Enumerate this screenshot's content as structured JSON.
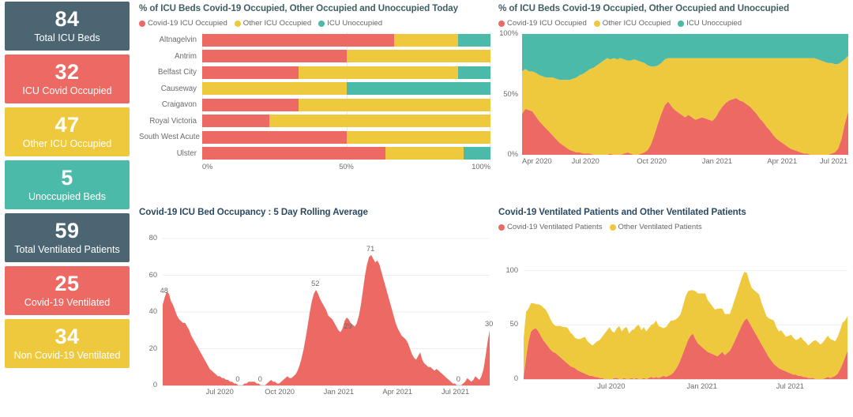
{
  "kpis": [
    {
      "value": "84",
      "label": "Total ICU Beds",
      "color": "#4b6573",
      "name": "total-icu-beds"
    },
    {
      "value": "32",
      "label": "ICU Covid Occupied",
      "color": "#ec6a63",
      "name": "icu-covid-occupied"
    },
    {
      "value": "47",
      "label": "Other ICU Occupied",
      "color": "#efc93d",
      "name": "other-icu-occupied"
    },
    {
      "value": "5",
      "label": "Unoccupied Beds",
      "color": "#4cbaa8",
      "name": "unoccupied-beds"
    },
    {
      "value": "59",
      "label": "Total Ventilated Patients",
      "color": "#4b6573",
      "name": "total-ventilated-patients"
    },
    {
      "value": "25",
      "label": "Covid-19 Ventilated",
      "color": "#ec6a63",
      "name": "covid-19-ventilated"
    },
    {
      "value": "34",
      "label": "Non Covid-19 Ventilated",
      "color": "#efc93d",
      "name": "non-covid-19-ventilated"
    }
  ],
  "colors": {
    "red": "#ec6a63",
    "yellow": "#efc93d",
    "teal": "#4cbaa8",
    "slate": "#4b6573",
    "title": "#3f5f63",
    "title_navy": "#2c4a62"
  },
  "panels": {
    "today": {
      "title": "% of ICU Beds Covid-19 Occupied, Other Occupied and Unoccupied Today",
      "legend": [
        "Covid-19 ICU Occupied",
        "Other ICU Occupied",
        "ICU Unoccupied"
      ]
    },
    "trend": {
      "title": "% of ICU Beds Covid-19 Occupied, Other Occupied and Unoccupied",
      "legend": [
        "Covid-19 ICU Occupied",
        "Other ICU Occupied",
        "ICU Unoccupied"
      ]
    },
    "rolling": {
      "title": "Covid-19 ICU Bed Occupancy : 5 Day Rolling Average",
      "legend": []
    },
    "vent": {
      "title": "Covid-19 Ventilated Patients and Other Ventilated Patients",
      "legend": [
        "Covid-19 Ventilated Patients",
        "Other Ventilated Patients"
      ]
    }
  },
  "chart_data": [
    {
      "type": "bar",
      "id": "icu-beds-today",
      "orientation": "horizontal",
      "stacked": true,
      "normalized": true,
      "title": "% of ICU Beds Covid-19 Occupied, Other Occupied and Unoccupied Today",
      "xlabel": "",
      "ylabel": "",
      "xlim": [
        0,
        100
      ],
      "xticks": [
        "0%",
        "50%",
        "100%"
      ],
      "xtick_values": [
        0,
        50,
        100
      ],
      "grid": true,
      "legend_position": "top",
      "categories": [
        "Altnagelvin",
        "Antrim",
        "Belfast City",
        "Causeway",
        "Craigavon",
        "Royal Victoria",
        "South West Acute",
        "Ulster"
      ],
      "series": [
        {
          "name": "Covid-19 ICU Occupied",
          "color": "#ec6a63",
          "values": [
            66.6,
            50.1,
            33.4,
            0,
            33.4,
            23.4,
            50.0,
            63.5
          ]
        },
        {
          "name": "Other ICU Occupied",
          "color": "#efc93d",
          "values": [
            22.3,
            49.9,
            55.5,
            50.0,
            66.6,
            76.6,
            50.0,
            27.3
          ]
        },
        {
          "name": "ICU Unoccupied",
          "color": "#4cbaa8",
          "values": [
            11.1,
            0,
            11.1,
            50.0,
            0,
            0,
            0,
            9.2
          ]
        }
      ]
    },
    {
      "type": "area",
      "id": "icu-beds-trend",
      "stacked": true,
      "normalized": true,
      "title": "% of ICU Beds Covid-19 Occupied, Other Occupied and Unoccupied",
      "xlabel": "",
      "ylabel": "",
      "ylim": [
        0,
        100
      ],
      "yticks": [
        "0%",
        "50%",
        "100%"
      ],
      "ytick_values": [
        0,
        50,
        100
      ],
      "xticks": [
        "Apr 2020",
        "Jul 2020",
        "Oct 2020",
        "Jan 2021",
        "Apr 2021",
        "Jul 2021"
      ],
      "grid": false,
      "legend_position": "top",
      "x_range": [
        "Apr 2020",
        "Aug 2021"
      ],
      "series": [
        {
          "name": "Covid-19 ICU Occupied",
          "color": "#ec6a63",
          "values": [
            34,
            38,
            37,
            36,
            32,
            28,
            25,
            22,
            19,
            16,
            13,
            10,
            8,
            6,
            4,
            3,
            2,
            2,
            1,
            1,
            1,
            0,
            0,
            0,
            0,
            0,
            1,
            0,
            0,
            0,
            1,
            2,
            1,
            0,
            0,
            1,
            2,
            4,
            9,
            17,
            26,
            34,
            41,
            44,
            40,
            37,
            35,
            33,
            31,
            33,
            31,
            29,
            30,
            31,
            30,
            29,
            28,
            31,
            36,
            40,
            43,
            45,
            46,
            47,
            45,
            44,
            42,
            40,
            37,
            34,
            30,
            27,
            23,
            20,
            16,
            13,
            11,
            9,
            7,
            5,
            4,
            3,
            2,
            1,
            1,
            0,
            0,
            0,
            0,
            0,
            0,
            1,
            2,
            5,
            13,
            26,
            36
          ]
        },
        {
          "name": "Other ICU Occupied",
          "color": "#efc93d",
          "values": [
            35,
            33,
            32,
            33,
            36,
            38,
            40,
            42,
            45,
            48,
            50,
            52,
            54,
            56,
            58,
            60,
            62,
            64,
            66,
            68,
            70,
            72,
            74,
            76,
            78,
            80,
            78,
            80,
            79,
            80,
            78,
            76,
            77,
            79,
            78,
            76,
            74,
            70,
            64,
            56,
            48,
            42,
            38,
            36,
            40,
            43,
            45,
            47,
            49,
            47,
            49,
            51,
            50,
            49,
            50,
            51,
            52,
            49,
            44,
            40,
            37,
            35,
            34,
            33,
            35,
            36,
            38,
            40,
            43,
            46,
            50,
            53,
            57,
            60,
            64,
            67,
            69,
            71,
            73,
            75,
            76,
            77,
            78,
            79,
            79,
            80,
            80,
            79,
            78,
            77,
            76,
            75,
            73,
            70,
            64,
            53,
            46
          ]
        },
        {
          "name": "ICU Unoccupied",
          "color": "#4cbaa8",
          "values": [
            31,
            29,
            31,
            31,
            32,
            34,
            35,
            36,
            36,
            36,
            37,
            38,
            38,
            38,
            38,
            37,
            36,
            34,
            33,
            31,
            29,
            28,
            26,
            24,
            22,
            20,
            21,
            20,
            21,
            20,
            21,
            22,
            22,
            21,
            22,
            23,
            24,
            26,
            27,
            27,
            26,
            24,
            21,
            20,
            20,
            20,
            20,
            20,
            20,
            20,
            20,
            20,
            20,
            20,
            20,
            20,
            20,
            20,
            20,
            20,
            20,
            20,
            20,
            20,
            20,
            20,
            20,
            20,
            20,
            20,
            20,
            20,
            20,
            20,
            20,
            20,
            20,
            20,
            20,
            20,
            20,
            20,
            20,
            20,
            20,
            20,
            20,
            21,
            22,
            23,
            24,
            24,
            25,
            25,
            23,
            21,
            18
          ]
        }
      ]
    },
    {
      "type": "area",
      "id": "covid-icu-rolling",
      "title": "Covid-19 ICU Bed Occupancy : 5 Day Rolling Average",
      "xlabel": "",
      "ylabel": "",
      "ylim": [
        0,
        80
      ],
      "yticks": [
        "0",
        "20",
        "40",
        "60",
        "80"
      ],
      "ytick_values": [
        0,
        20,
        40,
        60,
        80
      ],
      "xticks": [
        "Jul 2020",
        "Oct 2020",
        "Jan 2021",
        "Apr 2021",
        "Jul 2021"
      ],
      "grid": true,
      "color": "#ec6a63",
      "annotations": [
        {
          "label": "48",
          "value": 48
        },
        {
          "label": "0",
          "value": 0
        },
        {
          "label": "0",
          "value": 0
        },
        {
          "label": "52",
          "value": 52
        },
        {
          "label": "29",
          "value": 29
        },
        {
          "label": "71",
          "value": 71
        },
        {
          "label": "0",
          "value": 0
        },
        {
          "label": "30",
          "value": 30
        }
      ],
      "values": [
        44,
        48,
        51,
        50,
        46,
        44,
        41,
        38,
        36,
        35,
        34,
        34,
        32,
        30,
        27,
        25,
        23,
        21,
        19,
        17,
        15,
        13,
        11,
        9,
        8,
        7,
        6,
        5,
        5,
        4,
        4,
        3,
        3,
        2,
        2,
        1,
        1,
        0,
        0,
        0,
        1,
        1,
        2,
        2,
        2,
        2,
        1,
        1,
        0,
        0,
        0,
        1,
        2,
        3,
        2,
        2,
        1,
        1,
        2,
        3,
        4,
        5,
        4,
        4,
        5,
        6,
        8,
        11,
        15,
        20,
        26,
        33,
        40,
        46,
        50,
        52,
        50,
        47,
        45,
        43,
        41,
        38,
        37,
        36,
        34,
        32,
        30,
        29,
        31,
        35,
        37,
        36,
        34,
        33,
        32,
        34,
        38,
        44,
        52,
        60,
        66,
        70,
        71,
        69,
        67,
        68,
        66,
        62,
        58,
        54,
        50,
        46,
        42,
        38,
        34,
        31,
        29,
        27,
        26,
        25,
        23,
        20,
        17,
        15,
        14,
        16,
        18,
        14,
        12,
        11,
        10,
        10,
        9,
        8,
        9,
        8,
        7,
        6,
        5,
        4,
        3,
        2,
        1,
        1,
        0,
        0,
        0,
        1,
        2,
        4,
        3,
        2,
        3,
        5,
        4,
        3,
        5,
        9,
        16,
        24,
        30
      ]
    },
    {
      "type": "area",
      "id": "ventilated-patients",
      "stacked": true,
      "title": "Covid-19 Ventilated Patients and Other Ventilated Patients",
      "xlabel": "",
      "ylabel": "",
      "ylim": [
        0,
        110
      ],
      "yticks": [
        "0",
        "50",
        "100"
      ],
      "ytick_values": [
        0,
        50,
        100
      ],
      "xticks": [
        "Jul 2020",
        "Jan 2021",
        "Jul 2021"
      ],
      "grid": true,
      "legend_position": "top",
      "series": [
        {
          "name": "Covid-19 Ventilated Patients",
          "color": "#ec6a63",
          "values": [
            2,
            20,
            35,
            44,
            46,
            47,
            44,
            40,
            36,
            33,
            30,
            27,
            25,
            24,
            22,
            20,
            18,
            16,
            14,
            12,
            11,
            10,
            8,
            7,
            6,
            5,
            4,
            3,
            3,
            2,
            2,
            1,
            1,
            0,
            0,
            0,
            0,
            1,
            1,
            0,
            0,
            1,
            0,
            0,
            1,
            0,
            1,
            0,
            0,
            1,
            0,
            1,
            2,
            1,
            2,
            1,
            2,
            3,
            2,
            3,
            4,
            6,
            9,
            13,
            18,
            24,
            30,
            36,
            40,
            42,
            37,
            33,
            31,
            29,
            27,
            25,
            24,
            23,
            22,
            21,
            23,
            25,
            22,
            24,
            26,
            30,
            35,
            40,
            45,
            50,
            54,
            56,
            52,
            48,
            44,
            40,
            36,
            32,
            28,
            24,
            20,
            17,
            14,
            12,
            10,
            9,
            8,
            7,
            6,
            5,
            4,
            4,
            3,
            3,
            2,
            2,
            1,
            1,
            1,
            0,
            0,
            0,
            0,
            1,
            2,
            1,
            2,
            3,
            5,
            9,
            14,
            20,
            26
          ]
        },
        {
          "name": "Other Ventilated Patients",
          "color": "#efc93d",
          "values": [
            36,
            42,
            30,
            26,
            24,
            22,
            25,
            28,
            30,
            31,
            30,
            28,
            26,
            25,
            27,
            29,
            30,
            32,
            33,
            31,
            30,
            28,
            29,
            30,
            32,
            34,
            31,
            30,
            28,
            31,
            33,
            35,
            38,
            42,
            45,
            48,
            44,
            42,
            46,
            49,
            44,
            46,
            48,
            42,
            44,
            46,
            48,
            50,
            45,
            47,
            44,
            46,
            48,
            50,
            52,
            48,
            46,
            44,
            46,
            48,
            50,
            48,
            46,
            44,
            42,
            44,
            46,
            45,
            42,
            40,
            44,
            46,
            48,
            50,
            52,
            48,
            46,
            44,
            42,
            44,
            42,
            40,
            38,
            36,
            34,
            36,
            38,
            40,
            42,
            44,
            45,
            42,
            38,
            36,
            38,
            40,
            42,
            38,
            36,
            34,
            36,
            38,
            40,
            36,
            34,
            36,
            34,
            32,
            34,
            36,
            34,
            32,
            34,
            36,
            34,
            32,
            30,
            32,
            34,
            36,
            34,
            32,
            34,
            36,
            38,
            36,
            34,
            32,
            34,
            36,
            38,
            34,
            32
          ]
        }
      ]
    }
  ]
}
